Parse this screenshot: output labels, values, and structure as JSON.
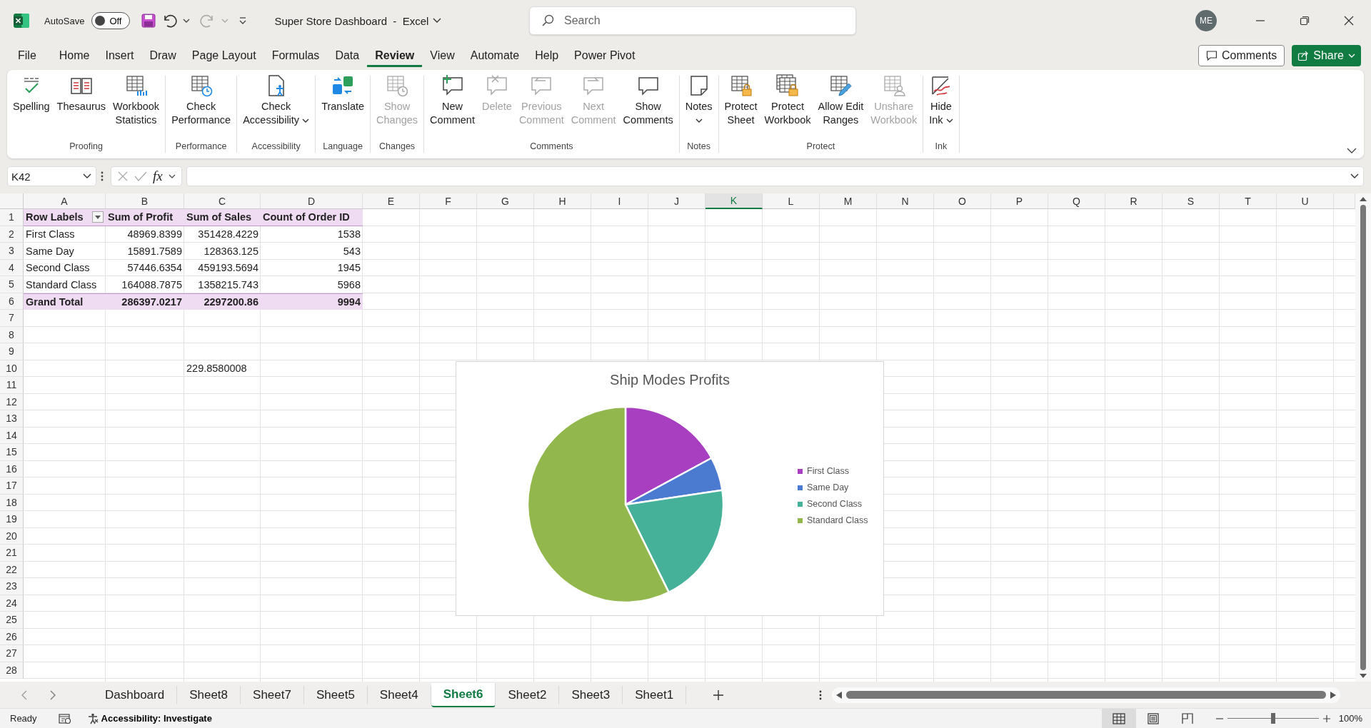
{
  "title_bar": {
    "autosave": {
      "label": "AutoSave",
      "on": false,
      "state_text": "Off"
    },
    "document_title": "Super Store Dashboard  -  Excel",
    "search": {
      "placeholder": "Search"
    },
    "avatar": "ME"
  },
  "menu_tabs": [
    {
      "label": "File",
      "selected": false
    },
    {
      "label": "Home",
      "selected": false
    },
    {
      "label": "Insert",
      "selected": false
    },
    {
      "label": "Draw",
      "selected": false
    },
    {
      "label": "Page Layout",
      "selected": false
    },
    {
      "label": "Formulas",
      "selected": false
    },
    {
      "label": "Data",
      "selected": false
    },
    {
      "label": "Review",
      "selected": true
    },
    {
      "label": "View",
      "selected": false
    },
    {
      "label": "Automate",
      "selected": false
    },
    {
      "label": "Help",
      "selected": false
    },
    {
      "label": "Power Pivot",
      "selected": false
    }
  ],
  "comments_button": "Comments",
  "share_button": "Share",
  "ribbon": {
    "groups": [
      {
        "label": "Proofing",
        "buttons": [
          {
            "lines": [
              "Spelling"
            ],
            "disabled": false,
            "dropdown": false
          },
          {
            "lines": [
              "Thesaurus"
            ],
            "disabled": false,
            "dropdown": false
          },
          {
            "lines": [
              "Workbook",
              "Statistics"
            ],
            "disabled": false,
            "dropdown": false
          }
        ]
      },
      {
        "label": "Performance",
        "buttons": [
          {
            "lines": [
              "Check",
              "Performance"
            ],
            "disabled": false,
            "dropdown": false
          }
        ]
      },
      {
        "label": "Accessibility",
        "buttons": [
          {
            "lines": [
              "Check",
              "Accessibility"
            ],
            "disabled": false,
            "dropdown": true
          }
        ]
      },
      {
        "label": "Language",
        "buttons": [
          {
            "lines": [
              "Translate"
            ],
            "disabled": false,
            "dropdown": false
          }
        ]
      },
      {
        "label": "Changes",
        "buttons": [
          {
            "lines": [
              "Show",
              "Changes"
            ],
            "disabled": true,
            "dropdown": false
          }
        ]
      },
      {
        "label": "Comments",
        "buttons": [
          {
            "lines": [
              "New",
              "Comment"
            ],
            "disabled": false,
            "dropdown": false
          },
          {
            "lines": [
              "Delete"
            ],
            "disabled": true,
            "dropdown": false
          },
          {
            "lines": [
              "Previous",
              "Comment"
            ],
            "disabled": true,
            "dropdown": false
          },
          {
            "lines": [
              "Next",
              "Comment"
            ],
            "disabled": true,
            "dropdown": false
          },
          {
            "lines": [
              "Show",
              "Comments"
            ],
            "disabled": false,
            "dropdown": false
          }
        ]
      },
      {
        "label": "Notes",
        "buttons": [
          {
            "lines": [
              "Notes"
            ],
            "disabled": false,
            "dropdown": true
          }
        ]
      },
      {
        "label": "Protect",
        "buttons": [
          {
            "lines": [
              "Protect",
              "Sheet"
            ],
            "disabled": false,
            "dropdown": false
          },
          {
            "lines": [
              "Protect",
              "Workbook"
            ],
            "disabled": false,
            "dropdown": false
          },
          {
            "lines": [
              "Allow Edit",
              "Ranges"
            ],
            "disabled": false,
            "dropdown": false
          },
          {
            "lines": [
              "Unshare",
              "Workbook"
            ],
            "disabled": true,
            "dropdown": false
          }
        ]
      },
      {
        "label": "Ink",
        "buttons": [
          {
            "lines": [
              "Hide",
              "Ink"
            ],
            "disabled": false,
            "dropdown": true
          }
        ]
      }
    ]
  },
  "formula_bar": {
    "name_box": "K42",
    "function_label": "fx"
  },
  "sheet": {
    "columns": [
      {
        "label": "A",
        "selected": false
      },
      {
        "label": "B",
        "selected": false
      },
      {
        "label": "C",
        "selected": false
      },
      {
        "label": "D",
        "selected": false
      },
      {
        "label": "E",
        "selected": false
      },
      {
        "label": "F",
        "selected": false
      },
      {
        "label": "G",
        "selected": false
      },
      {
        "label": "H",
        "selected": false
      },
      {
        "label": "I",
        "selected": false
      },
      {
        "label": "J",
        "selected": false
      },
      {
        "label": "K",
        "selected": true
      },
      {
        "label": "L",
        "selected": false
      },
      {
        "label": "M",
        "selected": false
      },
      {
        "label": "N",
        "selected": false
      },
      {
        "label": "O",
        "selected": false
      },
      {
        "label": "P",
        "selected": false
      },
      {
        "label": "Q",
        "selected": false
      },
      {
        "label": "R",
        "selected": false
      },
      {
        "label": "S",
        "selected": false
      },
      {
        "label": "T",
        "selected": false
      },
      {
        "label": "U",
        "selected": false
      }
    ],
    "rows": [
      {
        "number": "1",
        "kind": "pivot-header",
        "cells": {
          "A": "Row Labels",
          "B": "Sum of Profit",
          "C": "Sum of Sales",
          "D": "Count of Order ID"
        }
      },
      {
        "number": "2",
        "kind": "pivot-row",
        "cells": {
          "A": "First Class",
          "B": "48969.8399",
          "C": "351428.4229",
          "D": "1538"
        }
      },
      {
        "number": "3",
        "kind": "pivot-row",
        "cells": {
          "A": "Same Day",
          "B": "15891.7589",
          "C": "128363.125",
          "D": "543"
        }
      },
      {
        "number": "4",
        "kind": "pivot-row",
        "cells": {
          "A": "Second Class",
          "B": "57446.6354",
          "C": "459193.5694",
          "D": "1945"
        }
      },
      {
        "number": "5",
        "kind": "pivot-row",
        "cells": {
          "A": "Standard Class",
          "B": "164088.7875",
          "C": "1358215.743",
          "D": "5968"
        }
      },
      {
        "number": "6",
        "kind": "pivot-total",
        "cells": {
          "A": "Grand Total",
          "B": "286397.0217",
          "C": "2297200.86",
          "D": "9994"
        }
      },
      {
        "number": "7",
        "kind": "plain"
      },
      {
        "number": "8",
        "kind": "plain"
      },
      {
        "number": "9",
        "kind": "plain"
      },
      {
        "number": "10",
        "kind": "plain",
        "cells": {
          "C": "229.8580008"
        }
      },
      {
        "number": "11",
        "kind": "plain"
      },
      {
        "number": "12",
        "kind": "plain"
      },
      {
        "number": "13",
        "kind": "plain"
      },
      {
        "number": "14",
        "kind": "plain"
      },
      {
        "number": "15",
        "kind": "plain"
      },
      {
        "number": "16",
        "kind": "plain"
      },
      {
        "number": "17",
        "kind": "plain"
      },
      {
        "number": "18",
        "kind": "plain"
      },
      {
        "number": "19",
        "kind": "plain"
      },
      {
        "number": "20",
        "kind": "plain"
      },
      {
        "number": "21",
        "kind": "plain"
      },
      {
        "number": "22",
        "kind": "plain"
      },
      {
        "number": "23",
        "kind": "plain"
      },
      {
        "number": "24",
        "kind": "plain"
      },
      {
        "number": "25",
        "kind": "plain"
      },
      {
        "number": "26",
        "kind": "plain"
      },
      {
        "number": "27",
        "kind": "plain"
      },
      {
        "number": "28",
        "kind": "plain"
      }
    ]
  },
  "chart": {
    "chart_data": {
      "type": "pie",
      "title": "Ship Modes Profits",
      "legend": "right",
      "categories": [
        "First Class",
        "Same Day",
        "Second Class",
        "Standard Class"
      ],
      "values": [
        17.1,
        5.55,
        20.06,
        57.29
      ]
    },
    "legend": [
      {
        "color": "#a83fc0"
      },
      {
        "color": "#4a7bd0"
      },
      {
        "color": "#45b199"
      },
      {
        "color": "#92b84d"
      }
    ]
  },
  "sheet_tabs": [
    {
      "label": "Dashboard",
      "selected": false
    },
    {
      "label": "Sheet8",
      "selected": false
    },
    {
      "label": "Sheet7",
      "selected": false
    },
    {
      "label": "Sheet5",
      "selected": false
    },
    {
      "label": "Sheet4",
      "selected": false
    },
    {
      "label": "Sheet6",
      "selected": true
    },
    {
      "label": "Sheet2",
      "selected": false
    },
    {
      "label": "Sheet3",
      "selected": false
    },
    {
      "label": "Sheet1",
      "selected": false
    }
  ],
  "status_bar": {
    "ready": "Ready",
    "accessibility": "Accessibility: Investigate",
    "views": [
      {
        "kind": "normal",
        "selected": true
      },
      {
        "kind": "page-layout",
        "selected": false
      },
      {
        "kind": "page-break",
        "selected": false
      }
    ],
    "zoom": {
      "level": 0.5,
      "reading": "100%"
    }
  }
}
